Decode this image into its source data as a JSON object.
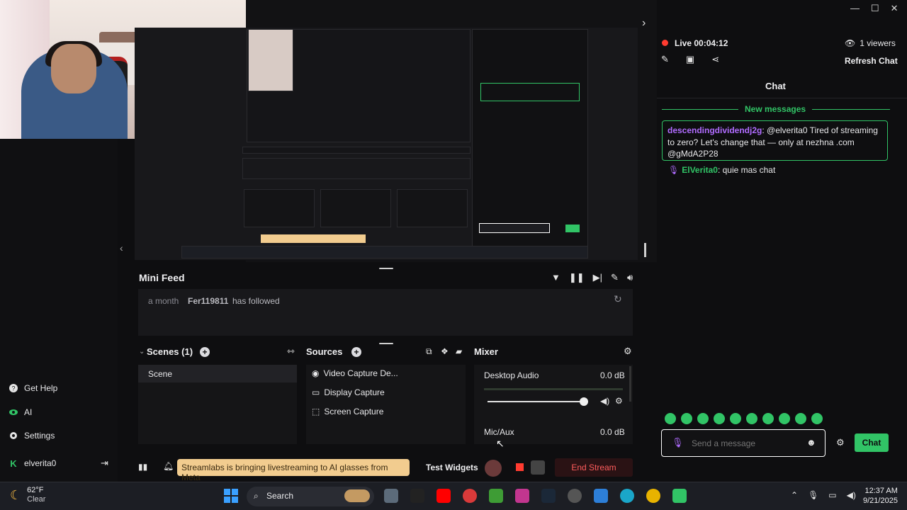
{
  "window": {
    "minimize": "—",
    "maximize": "☐",
    "close": "✕"
  },
  "left_sidebar": {
    "items": [
      {
        "label": "Get Help",
        "icon": "help-icon"
      },
      {
        "label": "AI",
        "icon": "eye-icon"
      },
      {
        "label": "Settings",
        "icon": "gear-icon"
      }
    ],
    "user": "elverita0"
  },
  "mini_feed": {
    "title": "Mini Feed",
    "events": [
      {
        "time": "a month",
        "user": "Fer119811",
        "action": "has followed"
      }
    ]
  },
  "scenes": {
    "title": "Scenes (1)",
    "items": [
      "Scene"
    ]
  },
  "sources": {
    "title": "Sources",
    "items": [
      "Video Capture De...",
      "Display Capture",
      "Screen Capture"
    ]
  },
  "mixer": {
    "title": "Mixer",
    "channels": [
      {
        "name": "Desktop Audio",
        "level": "0.0 dB",
        "volume_fraction": 0.92
      },
      {
        "name": "Mic/Aux",
        "level": "0.0 dB"
      }
    ]
  },
  "bottom_bar": {
    "promo": "Streamlabs is bringing livestreaming to AI glasses from Meta",
    "test_widgets": "Test Widgets",
    "end_stream": "End Stream"
  },
  "chat_panel": {
    "live_label": "Live",
    "live_time": "00:04:12",
    "viewers": "1 viewers",
    "refresh": "Refresh Chat",
    "title": "Chat",
    "new_messages": "New messages",
    "messages": [
      {
        "user": "descendingdividendj2g",
        "text": ": @elverita0 Tired of streaming to zero? Let's change that — only at nezhna .com @gMdA2P28"
      },
      {
        "user": "ElVerita0",
        "text": ": quie mas chat"
      }
    ],
    "input_placeholder": "Send a message",
    "send_label": "Chat"
  },
  "taskbar": {
    "weather_temp": "62°F",
    "weather_desc": "Clear",
    "search_label": "Search",
    "time": "12:37 AM",
    "date": "9/21/2025"
  },
  "colors": {
    "accent_green": "#31c466",
    "live_red": "#ff3b30",
    "promo_bg": "#f2cc8f",
    "user_purple": "#b06cff"
  }
}
